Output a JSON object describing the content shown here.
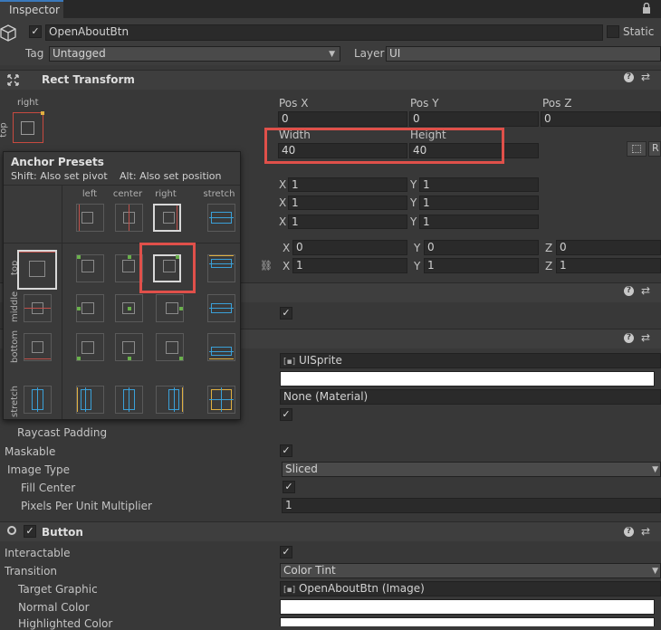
{
  "tab": {
    "title": "Inspector"
  },
  "object": {
    "name": "OpenAboutBtn",
    "static_label": "Static",
    "tag_label": "Tag",
    "tag_value": "Untagged",
    "layer_label": "Layer",
    "layer_value": "UI"
  },
  "rect_transform": {
    "title": "Rect Transform",
    "anchor_side_top": "right",
    "anchor_side_left": "top",
    "pos_x_label": "Pos X",
    "pos_y_label": "Pos Y",
    "pos_z_label": "Pos Z",
    "pos_x": "0",
    "pos_y": "0",
    "pos_z": "0",
    "width_label": "Width",
    "height_label": "Height",
    "width": "40",
    "height": "40",
    "anchor_min_x": "1",
    "anchor_min_y": "1",
    "anchor_max_x": "1",
    "anchor_max_y": "1",
    "pivot_x": "1",
    "pivot_y": "1",
    "rot_x": "0",
    "rot_y": "0",
    "rot_z": "0",
    "scale_x": "1",
    "scale_y": "1",
    "scale_z": "1",
    "raw_button_label": "R"
  },
  "anchor_presets": {
    "title": "Anchor Presets",
    "hint_shift": "Shift: Also set pivot",
    "hint_alt": "Alt: Also set position",
    "columns": [
      "left",
      "center",
      "right",
      "stretch"
    ],
    "rows": [
      "top",
      "middle",
      "bottom",
      "stretch"
    ]
  },
  "image": {
    "source_image": "UISprite",
    "material": "None (Material)",
    "raycast_padding_label": "Raycast Padding",
    "maskable_label": "Maskable",
    "image_type_label": "Image Type",
    "image_type_value": "Sliced",
    "fill_center_label": "Fill Center",
    "ppu_label": "Pixels Per Unit Multiplier",
    "ppu_value": "1"
  },
  "button": {
    "title": "Button",
    "interactable_label": "Interactable",
    "transition_label": "Transition",
    "transition_value": "Color Tint",
    "target_graphic_label": "Target Graphic",
    "target_graphic_value": "OpenAboutBtn (Image)",
    "normal_color_label": "Normal Color",
    "highlighted_color_label": "Highlighted Color"
  },
  "colors": {
    "accent_red": "#e0504a",
    "anchor_blue": "#3aa0d8",
    "anchor_green": "#6ab04c",
    "anchor_yellow": "#e0b040"
  }
}
